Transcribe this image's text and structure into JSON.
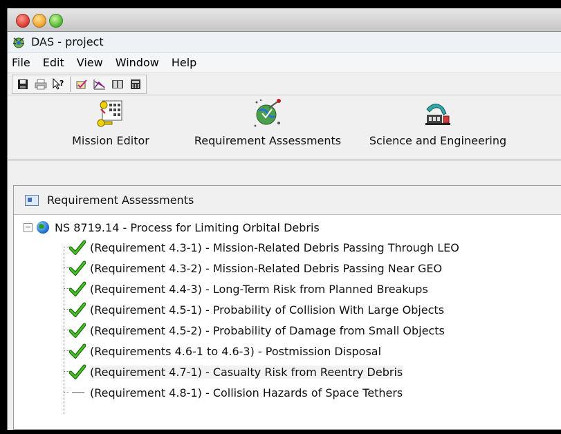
{
  "window": {
    "app_title": "DAS - project"
  },
  "menubar": {
    "items": [
      "File",
      "Edit",
      "View",
      "Window",
      "Help"
    ]
  },
  "toolbar": {
    "icons": [
      "save-icon",
      "print-icon",
      "help-cursor-icon",
      "assess-icon",
      "chart-icon",
      "book-icon",
      "calculator-icon"
    ]
  },
  "launchers": {
    "mission_editor": "Mission Editor",
    "requirement_assessments": "Requirement Assessments",
    "science_engineering": "Science and Engineering"
  },
  "panel": {
    "title": "Requirement Assessments",
    "root": "NS 8719.14 - Process for Limiting Orbital Debris",
    "items": [
      {
        "label": "(Requirement 4.3-1) - Mission-Related Debris Passing Through LEO",
        "status": "pass"
      },
      {
        "label": "(Requirement 4.3-2) - Mission-Related Debris Passing Near GEO",
        "status": "pass"
      },
      {
        "label": "(Requirement 4.4-3) - Long-Term Risk from Planned Breakups",
        "status": "pass"
      },
      {
        "label": "(Requirement 4.5-1) - Probability of Collision With Large Objects",
        "status": "pass"
      },
      {
        "label": "(Requirement 4.5-2) - Probability of Damage from Small Objects",
        "status": "pass"
      },
      {
        "label": "(Requirements 4.6-1 to 4.6-3) - Postmission Disposal",
        "status": "pass"
      },
      {
        "label": "(Requirement 4.7-1) - Casualty Risk from Reentry Debris",
        "status": "pass"
      },
      {
        "label": "(Requirement 4.8-1) - Collision Hazards of Space Tethers",
        "status": "na"
      }
    ]
  },
  "colors": {
    "check_green": "#3aa61c",
    "check_dark": "#1b6e10"
  }
}
